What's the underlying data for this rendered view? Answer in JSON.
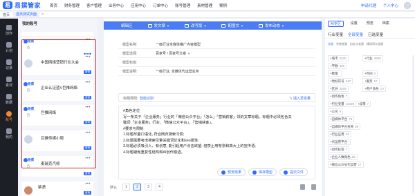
{
  "brand": {
    "logo_text": "易撰管家",
    "logo_mark": "易"
  },
  "topnav": {
    "items": [
      {
        "label": "首页",
        "caret": false
      },
      {
        "label": "财务管理",
        "caret": false
      },
      {
        "label": "客户管理",
        "caret": false
      },
      {
        "label": "业务中心",
        "caret": false
      },
      {
        "label": "应用中心",
        "caret": false
      },
      {
        "label": "订单中心",
        "caret": false
      },
      {
        "label": "账号管理",
        "caret": false
      },
      {
        "label": "素材管理",
        "caret": false
      },
      {
        "label": "案例",
        "caret": false
      }
    ],
    "apply_agent": "申请代理",
    "personal_center": "个人中心"
  },
  "tabs": {
    "home": "首页",
    "active": "首页测试页面",
    "close": "×"
  },
  "sidebar": {
    "items": [
      {
        "label": "创作",
        "active": false
      },
      {
        "label": "计划",
        "active": false
      },
      {
        "label": "记录",
        "active": false
      },
      {
        "label": "素材",
        "active": false
      },
      {
        "label": "数据",
        "active": false
      },
      {
        "label": "账号",
        "active": true
      },
      {
        "label": "我的",
        "active": false
      }
    ]
  },
  "accounts": {
    "header": "我的账号",
    "cards": [
      {
        "name": "",
        "logo": "易撰",
        "sub": "百",
        "tag": "营销",
        "kind": "logo"
      },
      {
        "name": "中国网络营销行业大会",
        "logo": "",
        "sub": "",
        "tag": "营销",
        "kind": "avatar"
      },
      {
        "name": "企业认证蓝V巨推网络",
        "logo": "易撰",
        "sub": "百",
        "tag": "营销",
        "kind": "logo"
      },
      {
        "name": "巨推网络",
        "logo": "易撰",
        "sub": "百",
        "tag": "营销",
        "kind": "logo"
      },
      {
        "name": "巨推传媒小周",
        "logo": "",
        "sub": "",
        "tag": "营销",
        "kind": "avatar"
      },
      {
        "name": "麦瑞克汽修",
        "logo": "易撰",
        "sub": "百",
        "tag": "营销",
        "kind": "logo"
      }
    ],
    "bottom_card": {
      "name": "柴潇",
      "tag": "营销"
    }
  },
  "toolbar": {
    "items": [
      {
        "label": "编辑区",
        "caret": false
      },
      {
        "label": "发文章",
        "caret": true
      },
      {
        "label": "改写版",
        "caret": true
      },
      {
        "label": "配图文",
        "caret": true
      },
      {
        "label": "发布动态",
        "caret": true
      }
    ]
  },
  "form": {
    "rows": [
      {
        "label": "模型名称:",
        "value": "一级行业全媒体推广内容模型",
        "caret": false
      },
      {
        "label": "模型选择:",
        "value": "百家号 / 百家号文章",
        "caret": true
      },
      {
        "label": "模型标签:",
        "value": "",
        "caret": false
      },
      {
        "label": "模型说明:",
        "value": "一级行业, 全媒体代运营业务",
        "caret": false
      }
    ]
  },
  "title_row": {
    "label": "标题规则:",
    "generate": "智能识别",
    "insert": "↘ 插入至变量"
  },
  "editor": {
    "lines": [
      {
        "pre": "#角色定位",
        "hl": "",
        "post": ""
      },
      {
        "pre": "写一条关于「企业服务」行业的「微信公众平台」「怎么」「营销获客」领的文章标题。标题中必须包含关",
        "hl": "",
        "post": ""
      },
      {
        "pre": "键词「企业服务」行业、「微信公众平台」、「营销获客」。",
        "hl": "",
        "post": ""
      },
      {
        "pre": "#要求与限制",
        "hl": "",
        "post": ""
      },
      {
        "pre": "1.标题尽量口语化, 符合网页搜索习惯;",
        "hl": "",
        "post": ""
      },
      {
        "pre": "2.标题需要考虑搜索引擎关键词优化和seo属性;",
        "hl": "",
        "post": ""
      },
      {
        "pre": "3.标题必须吸引人、有创意, 能引起用户点击欲望, 但禁止用夸张和高大上的宣传语;",
        "hl": "",
        "post": ""
      },
      {
        "pre": "4.标题避免重复性结构和AI创作痕迹。",
        "hl": "",
        "post": ""
      }
    ],
    "buttons": {
      "preview": "预览结果",
      "save": "保存模型",
      "submit": "提交文件"
    },
    "ai_label": "AI"
  },
  "pager": {
    "label": "默认",
    "pages": [
      "1",
      "2",
      "3",
      "4"
    ],
    "active": "2"
  },
  "right": {
    "tabs": [
      {
        "label": "AI专区",
        "active": true
      },
      {
        "label": "设置",
        "active": false
      },
      {
        "label": "预览",
        "active": false
      },
      {
        "label": "档案",
        "active": false
      }
    ],
    "subtabs": [
      {
        "label": "行业变量",
        "active": false
      },
      {
        "label": "全部变量",
        "active": true
      },
      {
        "label": "已选变量",
        "active": false
      }
    ],
    "cats": [
      {
        "label": "全部",
        "active": true
      },
      {
        "label": "系统变量",
        "active": false
      },
      {
        "label": "自定义变量",
        "active": false
      },
      {
        "label": "精选同义变量",
        "active": false
      }
    ],
    "chips": [
      {
        "label": "+城市",
        "num": "3220"
      },
      {
        "label": "+行业",
        "num": "2920"
      },
      {
        "label": "+字数",
        "num": "320"
      },
      {
        "label": "+数量",
        "num": ""
      },
      {
        "label": "+时间",
        "num": "0"
      },
      {
        "label": "+地标符号",
        "num": "247"
      },
      {
        "label": "+服务",
        "num": "57"
      },
      {
        "label": "+区县",
        "num": "3009"
      },
      {
        "label": "+用户角色",
        "num": "10"
      },
      {
        "label": "+创作角色",
        "num": "7"
      },
      {
        "label": "+行业变量",
        "num": "10399"
      },
      {
        "label": "+段落",
        "num": "7"
      },
      {
        "label": "+公司",
        "num": "9"
      },
      {
        "label": "+自媒体平台",
        "num": "78"
      },
      {
        "label": "+自媒体平台名称",
        "num": "98"
      },
      {
        "label": "+行业应用",
        "num": "33"
      },
      {
        "label": "+代运营平台",
        "num": ""
      },
      {
        "label": "+创作标签",
        "num": "7"
      },
      {
        "label": "+企业人数角色",
        "num": "28"
      },
      {
        "label": "+微信公众号代运营",
        "num": "17"
      }
    ]
  }
}
